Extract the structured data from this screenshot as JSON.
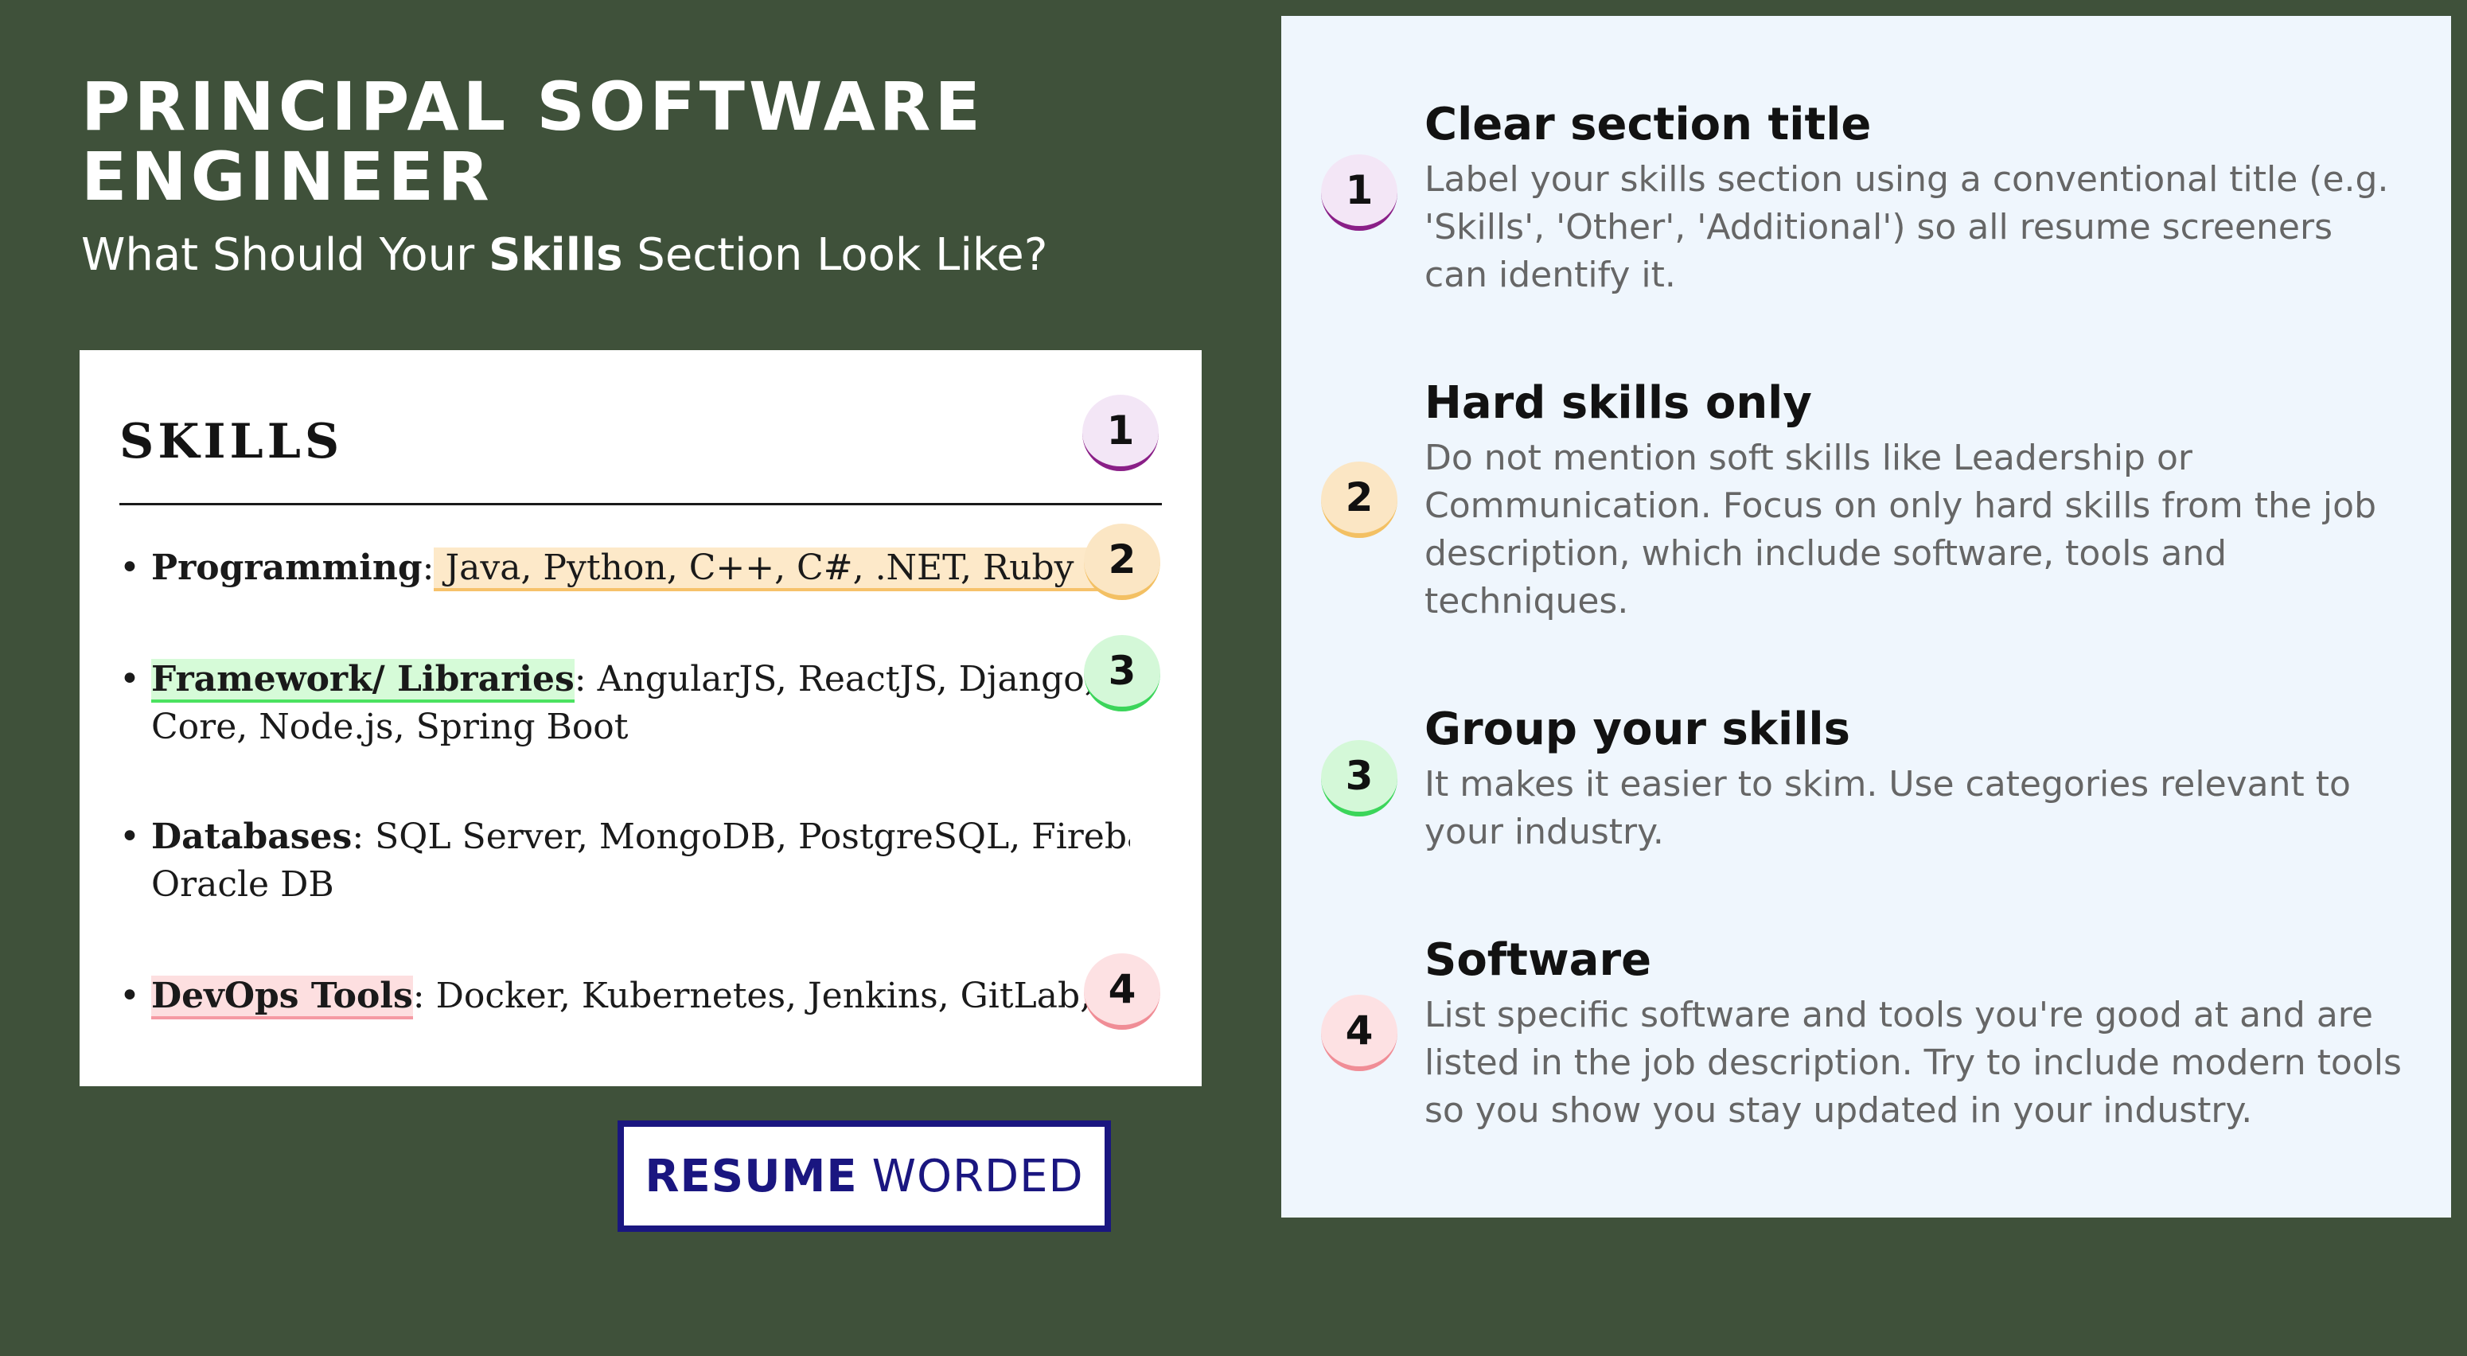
{
  "header": {
    "title": "PRINCIPAL SOFTWARE ENGINEER",
    "subtitle_pre": "What Should Your ",
    "subtitle_bold": "Skills",
    "subtitle_post": " Section Look Like?"
  },
  "resume": {
    "heading": "SKILLS",
    "items": [
      {
        "category": "Programming",
        "sep": ":",
        "text": " Java, Python, C++, C#, .NET, Ruby on Rails",
        "line2": "",
        "badge": "1"
      },
      {
        "category": "Framework/ Libraries",
        "sep": ":",
        "text": " AngularJS, ReactJS, Django, .NET",
        "line2": "Core, Node.js, Spring Boot",
        "badge": "3"
      },
      {
        "category": "Databases",
        "sep": ":",
        "text": " SQL Server, MongoDB, PostgreSQL, Firebase,",
        "line2": "Oracle DB",
        "badge": ""
      },
      {
        "category": "DevOps Tools",
        "sep": ":",
        "text": " Docker, Kubernetes, Jenkins, GitLab, Ans",
        "line2": "",
        "badge": "4"
      }
    ],
    "badges": [
      "1",
      "2",
      "3",
      "4"
    ]
  },
  "logo": {
    "bold": "RESUME",
    "regular": "WORDED",
    "color": "#1a1680"
  },
  "tips": [
    {
      "number": "1",
      "title": "Clear section title",
      "desc": "Label your skills section using a conventional title (e.g. 'Skills', 'Other', 'Additional') so all resume screeners can identify it."
    },
    {
      "number": "2",
      "title": "Hard skills only",
      "desc": "Do not mention soft skills like Leadership or Communication. Focus on only hard skills from the job description, which include software, tools and techniques."
    },
    {
      "number": "3",
      "title": "Group your skills",
      "desc": "It makes it easier to skim. Use categories relevant to your industry."
    },
    {
      "number": "4",
      "title": "Software",
      "desc": "List specific software and tools you're good at and are listed in the job description. Try to include modern tools so you show you stay updated in your industry."
    }
  ],
  "colors": {
    "background": "#3f513a",
    "panel": "#eff6fd",
    "badge1": "#8a1f87",
    "badge2": "#f3c063",
    "badge3": "#3bd55a",
    "badge4": "#f08d96"
  }
}
